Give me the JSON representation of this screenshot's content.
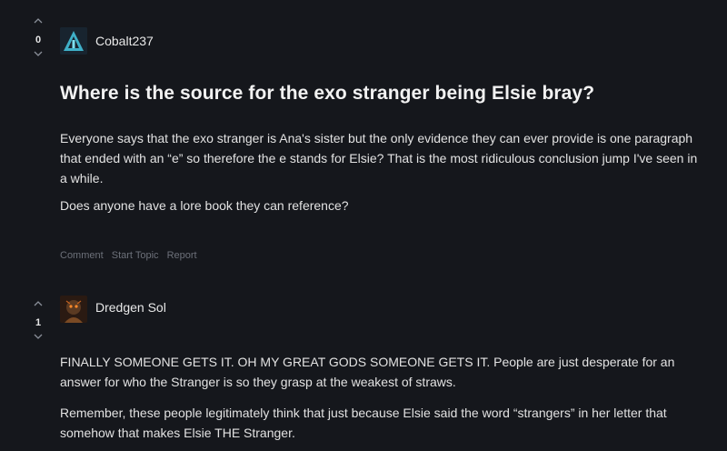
{
  "posts": [
    {
      "score": "0",
      "username": "Cobalt237",
      "avatar_icon": "cobalt-emblem-icon",
      "title": "Where is the source for the exo stranger being Elsie bray?",
      "paragraphs": [
        "Everyone says that the exo stranger is Ana's sister but the only evidence they can ever provide is one paragraph that ended with an “e” so therefore the e stands for Elsie? That is the most ridiculous conclusion jump I've seen in a while.",
        "Does anyone have a lore book they can reference?"
      ],
      "actions": {
        "comment": "Comment",
        "start_topic": "Start Topic",
        "report": "Report"
      }
    },
    {
      "score": "1",
      "username": "Dredgen Sol",
      "avatar_icon": "dredgen-portrait-icon",
      "paragraphs": [
        "FINALLY SOMEONE GETS IT. OH MY GREAT GODS SOMEONE GETS IT. People are just desperate for an answer for who the Stranger is so they grasp at the weakest of straws.",
        "Remember, these people legitimately think that just because Elsie said the word “strangers” in her letter that somehow that makes Elsie THE Stranger."
      ]
    }
  ],
  "colors": {
    "background": "#15171c",
    "text": "#e6e6e6",
    "muted": "#6c7079"
  }
}
